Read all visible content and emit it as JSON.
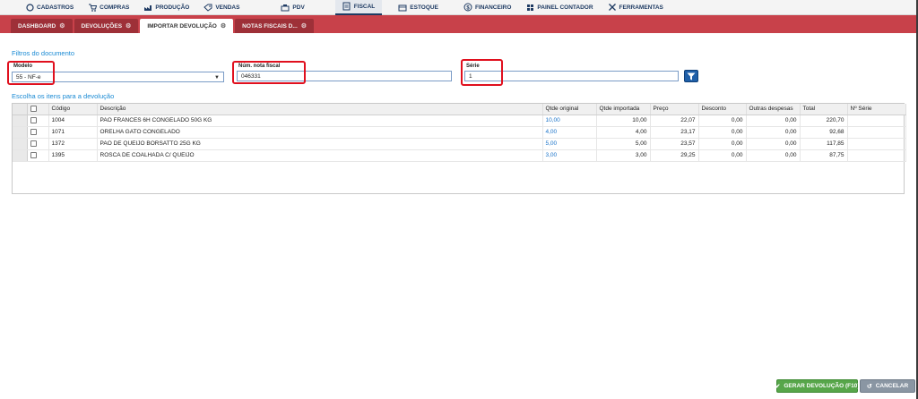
{
  "menu": [
    {
      "label": "CADASTROS",
      "icon": "circle-icon"
    },
    {
      "label": "COMPRAS",
      "icon": "cart-icon"
    },
    {
      "label": "PRODUÇÃO",
      "icon": "factory-icon"
    },
    {
      "label": "VENDAS",
      "icon": "tag-icon"
    },
    {
      "label": "PDV",
      "icon": "register-icon"
    },
    {
      "label": "FISCAL",
      "icon": "document-icon"
    },
    {
      "label": "ESTOQUE",
      "icon": "box-icon"
    },
    {
      "label": "FINANCEIRO",
      "icon": "dollar-icon"
    },
    {
      "label": "PAINEL CONTADOR",
      "icon": "grid-icon"
    },
    {
      "label": "FERRAMENTAS",
      "icon": "tools-icon"
    }
  ],
  "tabs": [
    {
      "label": "DASHBOARD"
    },
    {
      "label": "DEVOLUÇÕES"
    },
    {
      "label": "IMPORTAR DEVOLUÇÃO"
    },
    {
      "label": "NOTAS FISCAIS D..."
    }
  ],
  "filters": {
    "title": "Filtros do documento",
    "modelo_label": "Modelo",
    "modelo_value": "55 - NF-e",
    "nota_label": "Núm. nota fiscal",
    "nota_value": "046331",
    "serie_label": "Série",
    "serie_value": "1"
  },
  "items": {
    "title": "Escolha os itens para a devolução",
    "columns": {
      "codigo": "Código",
      "descricao": "Descrição",
      "qtde_original": "Qtde original",
      "qtde_importada": "Qtde importada",
      "preco": "Preço",
      "desconto": "Desconto",
      "outras": "Outras despesas",
      "total": "Total",
      "serie": "Nº Série"
    },
    "rows": [
      {
        "codigo": "1004",
        "descricao": "PAO FRANCES 6H CONGELADO 50G KG",
        "qtde_original": "10,00",
        "qtde_importada": "10,00",
        "preco": "22,07",
        "desconto": "0,00",
        "outras": "0,00",
        "total": "220,70",
        "serie": ""
      },
      {
        "codigo": "1071",
        "descricao": "ORELHA GATO CONGELADO",
        "qtde_original": "4,00",
        "qtde_importada": "4,00",
        "preco": "23,17",
        "desconto": "0,00",
        "outras": "0,00",
        "total": "92,68",
        "serie": ""
      },
      {
        "codigo": "1372",
        "descricao": "PAO DE QUEIJO BORSATTO 25G KG",
        "qtde_original": "5,00",
        "qtde_importada": "5,00",
        "preco": "23,57",
        "desconto": "0,00",
        "outras": "0,00",
        "total": "117,85",
        "serie": ""
      },
      {
        "codigo": "1395",
        "descricao": "ROSCA DE COALHADA C/ QUEIJO",
        "qtde_original": "3,00",
        "qtde_importada": "3,00",
        "preco": "29,25",
        "desconto": "0,00",
        "outras": "0,00",
        "total": "87,75",
        "serie": ""
      }
    ]
  },
  "footer": {
    "generate_label": "GERAR DEVOLUÇÃO (F10)",
    "cancel_label": "CANCELAR"
  },
  "colors": {
    "tab_bar": "#c8414a",
    "accent": "#1a8ad4",
    "highlight": "#e0101e",
    "generate": "#57a64a",
    "cancel": "#8a96a3"
  }
}
